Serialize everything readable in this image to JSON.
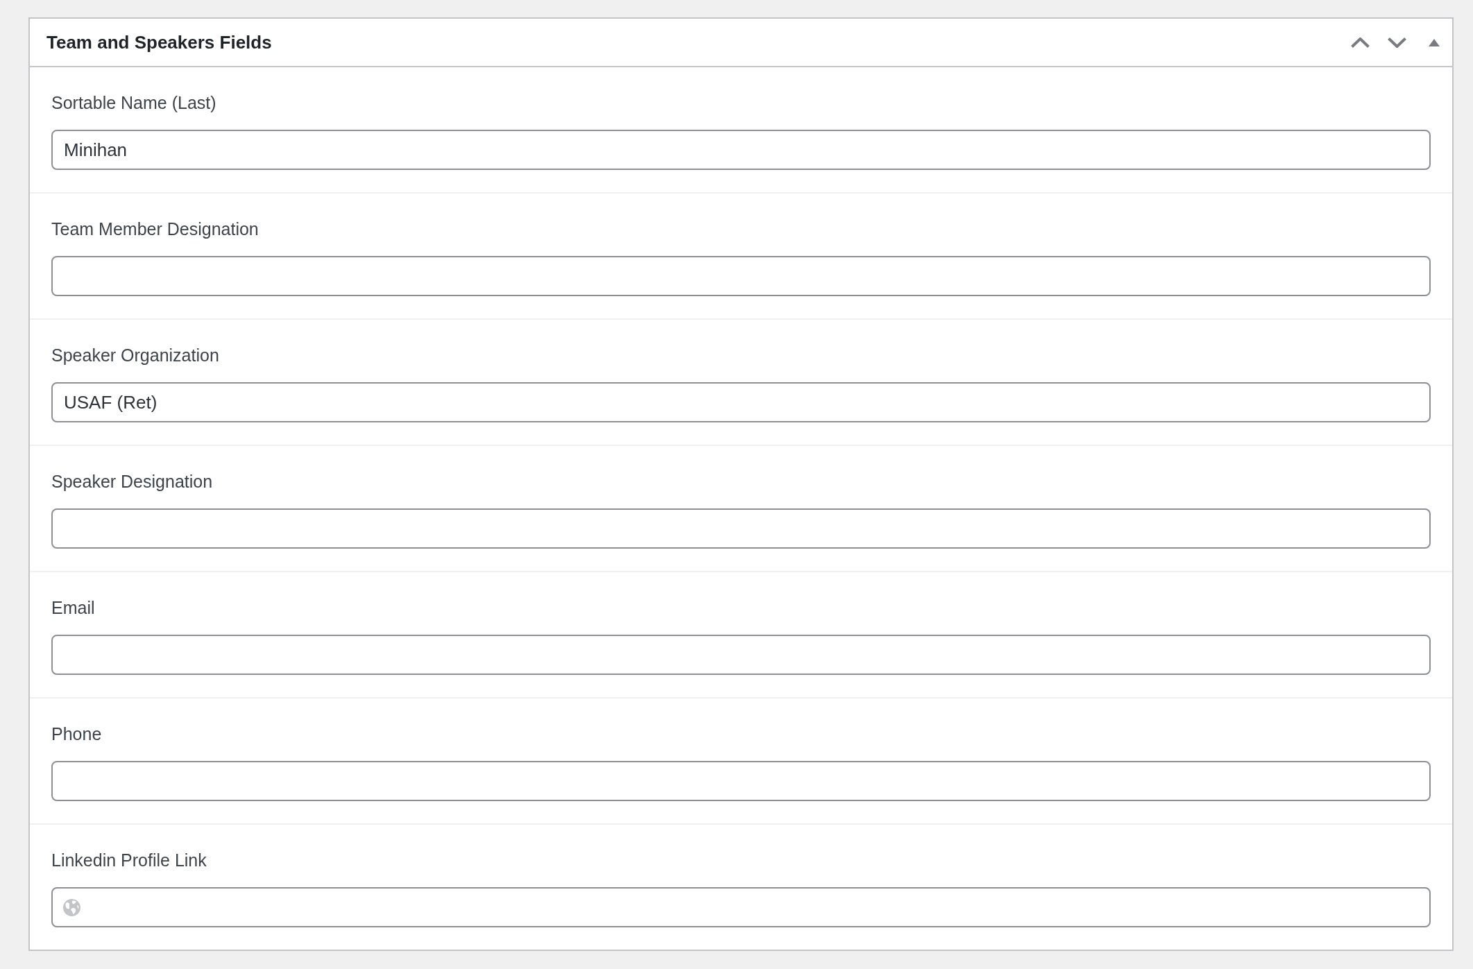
{
  "panel": {
    "title": "Team and Speakers Fields"
  },
  "fields": [
    {
      "kind": "text",
      "label": "Sortable Name (Last)",
      "value": "Minihan"
    },
    {
      "kind": "text",
      "label": "Team Member Designation"
    },
    {
      "kind": "text",
      "label": "Speaker Organization",
      "value": "USAF (Ret)"
    },
    {
      "kind": "text",
      "label": "Speaker Designation"
    },
    {
      "kind": "text",
      "label": "Email"
    },
    {
      "kind": "text",
      "label": "Phone"
    },
    {
      "kind": "url",
      "label": "Linkedin Profile Link"
    }
  ]
}
